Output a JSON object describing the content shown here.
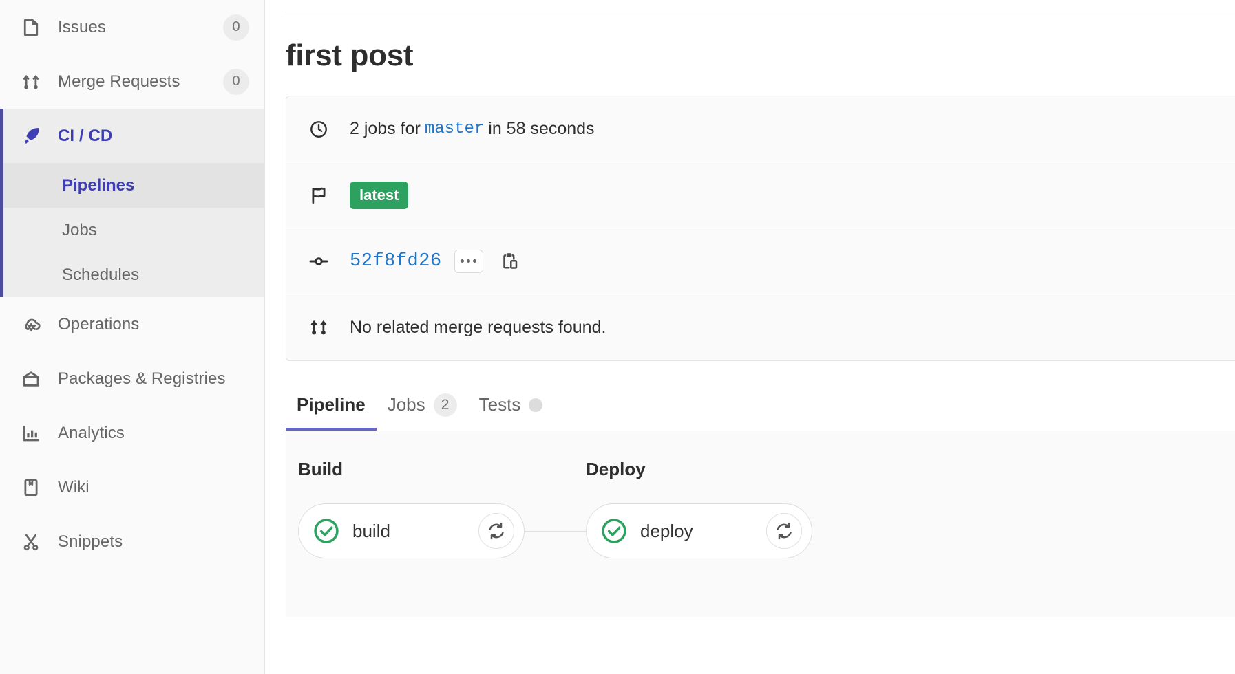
{
  "sidebar": {
    "items": [
      {
        "label": "Issues",
        "icon": "issues-icon",
        "count": "0"
      },
      {
        "label": "Merge Requests",
        "icon": "merge-requests-icon",
        "count": "0"
      }
    ],
    "active_section": {
      "label": "CI / CD",
      "icon": "rocket-icon",
      "subitems": [
        {
          "label": "Pipelines",
          "active": true
        },
        {
          "label": "Jobs",
          "active": false
        },
        {
          "label": "Schedules",
          "active": false
        }
      ]
    },
    "lower_items": [
      {
        "label": "Operations",
        "icon": "cloud-gear-icon"
      },
      {
        "label": "Packages & Registries",
        "icon": "package-icon"
      },
      {
        "label": "Analytics",
        "icon": "chart-bar-icon"
      },
      {
        "label": "Wiki",
        "icon": "book-icon"
      },
      {
        "label": "Snippets",
        "icon": "scissors-icon"
      }
    ]
  },
  "main": {
    "page_title": "first post",
    "info": {
      "jobs_count_text": "2 jobs for",
      "branch": "master",
      "duration_text": "in 58 seconds",
      "clock_icon": "clock-icon",
      "flag_icon": "flag-icon",
      "latest_badge": "latest",
      "commit_icon": "commit-node-icon",
      "commit_sha": "52f8fd26",
      "ellipsis_label": "...",
      "copy_icon": "copy-to-clipboard-icon",
      "merge_icon": "merge-requests-icon",
      "merge_requests_text": "No related merge requests found."
    },
    "tabs": [
      {
        "label": "Pipeline",
        "active": true,
        "badge": null,
        "dot": false
      },
      {
        "label": "Jobs",
        "active": false,
        "badge": "2",
        "dot": false
      },
      {
        "label": "Tests",
        "active": false,
        "badge": null,
        "dot": true
      }
    ],
    "pipeline_graph": {
      "stages": [
        {
          "name": "Build",
          "jobs": [
            {
              "name": "build",
              "status": "success",
              "retry_icon": "retry-icon"
            }
          ]
        },
        {
          "name": "Deploy",
          "jobs": [
            {
              "name": "deploy",
              "status": "success",
              "retry_icon": "retry-icon"
            }
          ]
        }
      ]
    }
  },
  "colors": {
    "accent_purple": "#3d3db4",
    "tab_underline": "#6666c4",
    "link_blue": "#1f75cb",
    "success_green": "#2da160",
    "badge_green": "#2da160",
    "sidebar_bg": "#fafafa",
    "active_bg": "#e3e3e3"
  }
}
